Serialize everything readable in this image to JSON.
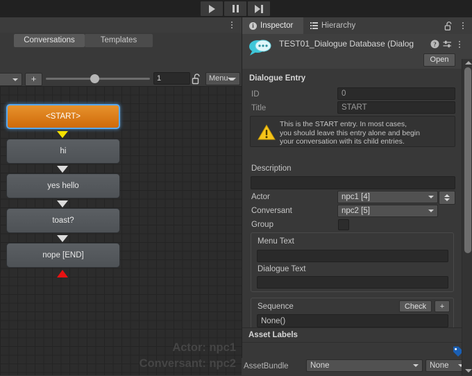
{
  "toolbar": {
    "play_label": "play-icon",
    "pause_label": "pause-icon",
    "step_label": "step-icon"
  },
  "editor_window": {
    "tabs": [
      {
        "label": "Conversations",
        "selected": true
      },
      {
        "label": "Templates",
        "selected": false
      }
    ],
    "controls": {
      "conversation_dropdown_value": "",
      "add_button_label": "+",
      "zoom_value": "1",
      "lock_icon": "lock-open-icon",
      "menu_label": "Menu"
    },
    "canvas": {
      "nodes": [
        {
          "label": "<START>",
          "type": "start"
        },
        {
          "label": "hi",
          "type": "normal"
        },
        {
          "label": "yes hello",
          "type": "normal"
        },
        {
          "label": "toast?",
          "type": "normal"
        },
        {
          "label": "nope [END]",
          "type": "normal"
        }
      ],
      "watermark_actor": "Actor: npc1",
      "watermark_conversant": "Conversant: npc2"
    }
  },
  "inspector": {
    "tabs": [
      {
        "label": "Inspector",
        "icon": "info-icon",
        "selected": true
      },
      {
        "label": "Hierarchy",
        "icon": "list-icon",
        "selected": false
      }
    ],
    "lock_icon": "lock-open-icon",
    "menu_icon": "kebab-icon",
    "asset": {
      "title": "TEST01_Dialogue Database (Dialog",
      "icon": "dialogue-database-icon",
      "help_icon": "help-icon",
      "preset_icon": "preset-icon",
      "kebab_icon": "kebab-icon",
      "open_button": "Open"
    },
    "dialogue_entry": {
      "section_title": "Dialogue Entry",
      "id_label": "ID",
      "id_value": "0",
      "title_label": "Title",
      "title_value": "START",
      "warning_icon": "warning-icon",
      "warning_text": "This is the START entry. In most cases, you should leave this entry alone and begin your conversation with its child entries.",
      "description_label": "Description",
      "description_value": "",
      "actor_label": "Actor",
      "actor_value": "npc1 [4]",
      "conversant_label": "Conversant",
      "conversant_value": "npc2 [5]",
      "group_label": "Group",
      "group_checked": false,
      "menu_text_label": "Menu Text",
      "menu_text_value": "",
      "dialogue_text_label": "Dialogue Text",
      "dialogue_text_value": "",
      "sequence_label": "Sequence",
      "sequence_check_button": "Check",
      "sequence_add_button": "+",
      "sequence_value": "None()"
    },
    "asset_labels": {
      "section_title": "Asset Labels",
      "tag_icon": "tag-icon",
      "assetbundle_label": "AssetBundle",
      "assetbundle_value": "None",
      "assetbundle_variant": "None"
    },
    "scrollbar": {
      "up_icon": "scroll-up-icon",
      "down_icon": "scroll-down-icon"
    }
  }
}
